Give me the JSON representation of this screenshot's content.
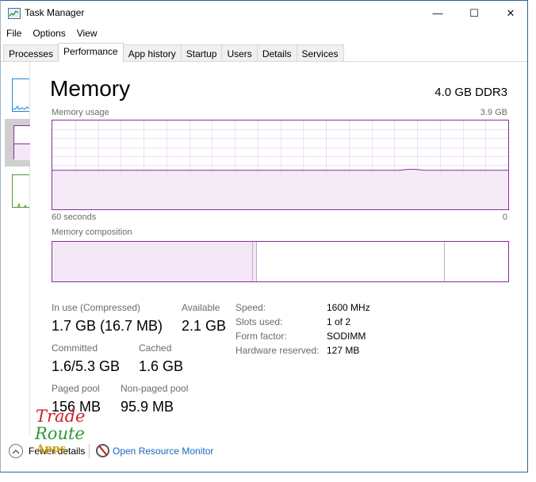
{
  "window": {
    "title": "Task Manager",
    "minimize_glyph": "—",
    "maximize_glyph": "☐",
    "close_glyph": "✕"
  },
  "menu": [
    "File",
    "Options",
    "View"
  ],
  "tabs": [
    {
      "label": "Processes",
      "active": false
    },
    {
      "label": "Performance",
      "active": true
    },
    {
      "label": "App history",
      "active": false
    },
    {
      "label": "Startup",
      "active": false
    },
    {
      "label": "Users",
      "active": false
    },
    {
      "label": "Details",
      "active": false
    },
    {
      "label": "Services",
      "active": false
    }
  ],
  "memory": {
    "title": "Memory",
    "spec": "4.0 GB DDR3",
    "usage_label": "Memory usage",
    "usage_max": "3.9 GB",
    "time_left": "60 seconds",
    "time_right": "0",
    "composition_label": "Memory composition",
    "composition": {
      "in_use_fraction": 0.44,
      "modified_fraction": 0.01,
      "standby_end_fraction": 0.86
    },
    "usage_history": [
      0.44,
      0.44,
      0.44,
      0.44,
      0.44,
      0.44,
      0.44,
      0.44,
      0.44,
      0.44,
      0.44,
      0.44,
      0.44,
      0.44,
      0.44,
      0.44,
      0.44,
      0.44,
      0.44,
      0.44,
      0.44,
      0.44,
      0.44,
      0.44,
      0.44,
      0.44,
      0.44,
      0.44,
      0.44,
      0.44,
      0.44,
      0.44,
      0.44,
      0.44,
      0.44,
      0.44,
      0.44,
      0.44,
      0.44,
      0.44,
      0.44,
      0.44,
      0.44,
      0.44,
      0.44,
      0.44,
      0.45,
      0.45,
      0.44,
      0.44,
      0.44,
      0.44,
      0.44,
      0.44,
      0.44,
      0.44,
      0.44,
      0.44,
      0.44,
      0.44
    ],
    "stats": {
      "in_use_label": "In use (Compressed)",
      "in_use_value": "1.7 GB (16.7 MB)",
      "available_label": "Available",
      "available_value": "2.1 GB",
      "committed_label": "Committed",
      "committed_value": "1.6/5.3 GB",
      "cached_label": "Cached",
      "cached_value": "1.6 GB",
      "paged_label": "Paged pool",
      "paged_value": "156 MB",
      "nonpaged_label": "Non-paged pool",
      "nonpaged_value": "95.9 MB"
    },
    "details": {
      "speed_label": "Speed:",
      "speed_value": "1600 MHz",
      "slots_label": "Slots used:",
      "slots_value": "1 of 2",
      "form_label": "Form factor:",
      "form_value": "SODIMM",
      "reserved_label": "Hardware reserved:",
      "reserved_value": "127 MB"
    }
  },
  "footer": {
    "fewer_details": "Fewer details",
    "open_resource_monitor": "Open Resource Monitor"
  },
  "watermark": {
    "line1": "Trade",
    "line2": "Route",
    "line3": "Apps"
  },
  "colors": {
    "memory_accent": "#8b2b9c",
    "memory_fill": "#f3e7f5",
    "link": "#1a67c1"
  }
}
